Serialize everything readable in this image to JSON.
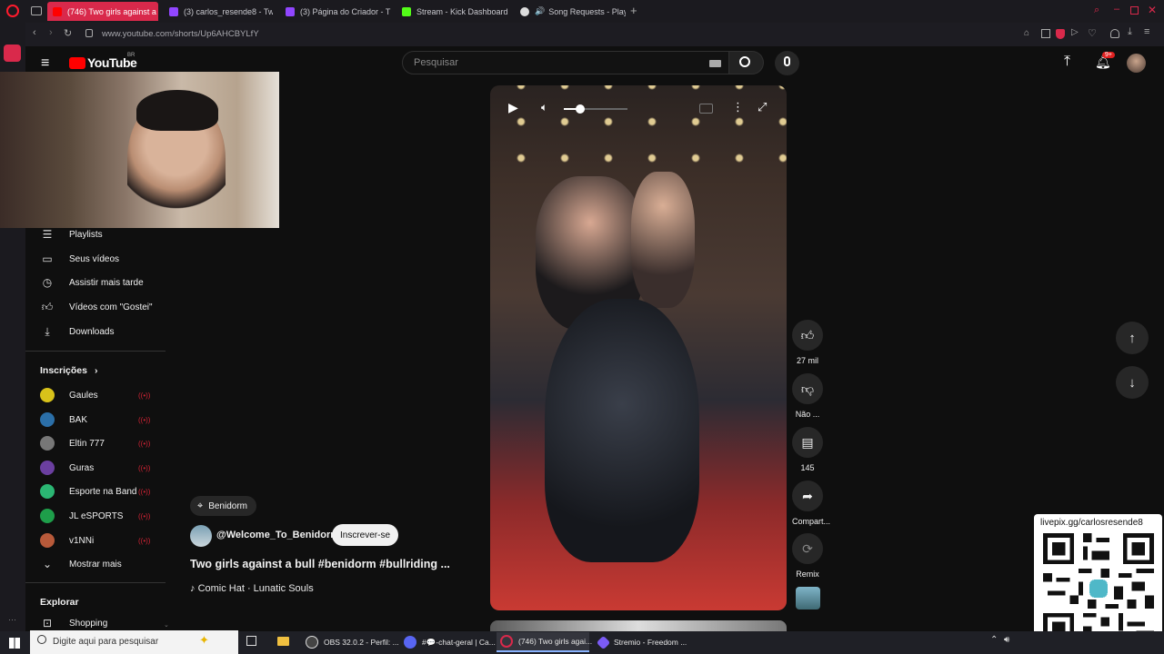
{
  "browser": {
    "tabs": [
      {
        "label": "(746) Two girls against a b",
        "color": "#ff0000",
        "active": true
      },
      {
        "label": "(3) carlos_resende8 - Tw",
        "color": "#9146ff",
        "active": false
      },
      {
        "label": "(3) Página do Criador - T",
        "color": "#9146ff",
        "active": false
      },
      {
        "label": "Stream - Kick Dashboard",
        "color": "#53fc18",
        "active": false
      },
      {
        "label": "Song Requests - Play",
        "color": "#dddddd",
        "active": false
      }
    ],
    "url": "www.youtube.com/shorts/Up6AHCBYLfY"
  },
  "youtube": {
    "logo_text": "YouTube",
    "logo_region": "BR",
    "search_placeholder": "Pesquisar",
    "notif_count": "9+"
  },
  "sidebar": {
    "items": [
      {
        "label": "Playlists",
        "icon": "playlist-icon"
      },
      {
        "label": "Seus vídeos",
        "icon": "video-icon"
      },
      {
        "label": "Assistir mais tarde",
        "icon": "clock-icon"
      },
      {
        "label": "Vídeos com \"Gostei\"",
        "icon": "thumb-up-icon"
      },
      {
        "label": "Downloads",
        "icon": "download-icon"
      }
    ],
    "subs_heading": "Inscrições",
    "subscriptions": [
      {
        "label": "Gaules",
        "color": "#d8c21a"
      },
      {
        "label": "BAK",
        "color": "#2b6fa8"
      },
      {
        "label": "Eltin 777",
        "color": "#777777"
      },
      {
        "label": "Guras",
        "color": "#6b3fa0"
      },
      {
        "label": "Esporte na Band",
        "color": "#2bb673"
      },
      {
        "label": "JL eSPORTS",
        "color": "#1e9e4a"
      },
      {
        "label": "v1NNi",
        "color": "#b85a3a"
      }
    ],
    "show_more": "Mostrar mais",
    "explore_heading": "Explorar",
    "shopping": "Shopping"
  },
  "video": {
    "location": "Benidorm",
    "channel": "@Welcome_To_Benidorm",
    "subscribe": "Inscrever-se",
    "title": "Two girls against a bull #benidorm #bullriding ...",
    "song": "Comic Hat · Lunatic Souls",
    "volume_level": 0.25
  },
  "actions": {
    "likes": "27 mil",
    "dislike": "Não ...",
    "comments": "145",
    "share": "Compart...",
    "remix": "Remix"
  },
  "qr": {
    "text": "livepix.gg/carlosresende8"
  },
  "taskbar": {
    "search_placeholder": "Digite aqui para pesquisar",
    "apps": [
      {
        "label": "OBS 32.0.2 - Perfil: ...",
        "color": "#444444"
      },
      {
        "label": "#💬-chat-geral | Ca...",
        "color": "#5865f2"
      },
      {
        "label": "(746) Two girls agai...",
        "color": "#d9294b"
      },
      {
        "label": "Stremio - Freedom ...",
        "color": "#7b5bf5"
      }
    ]
  }
}
